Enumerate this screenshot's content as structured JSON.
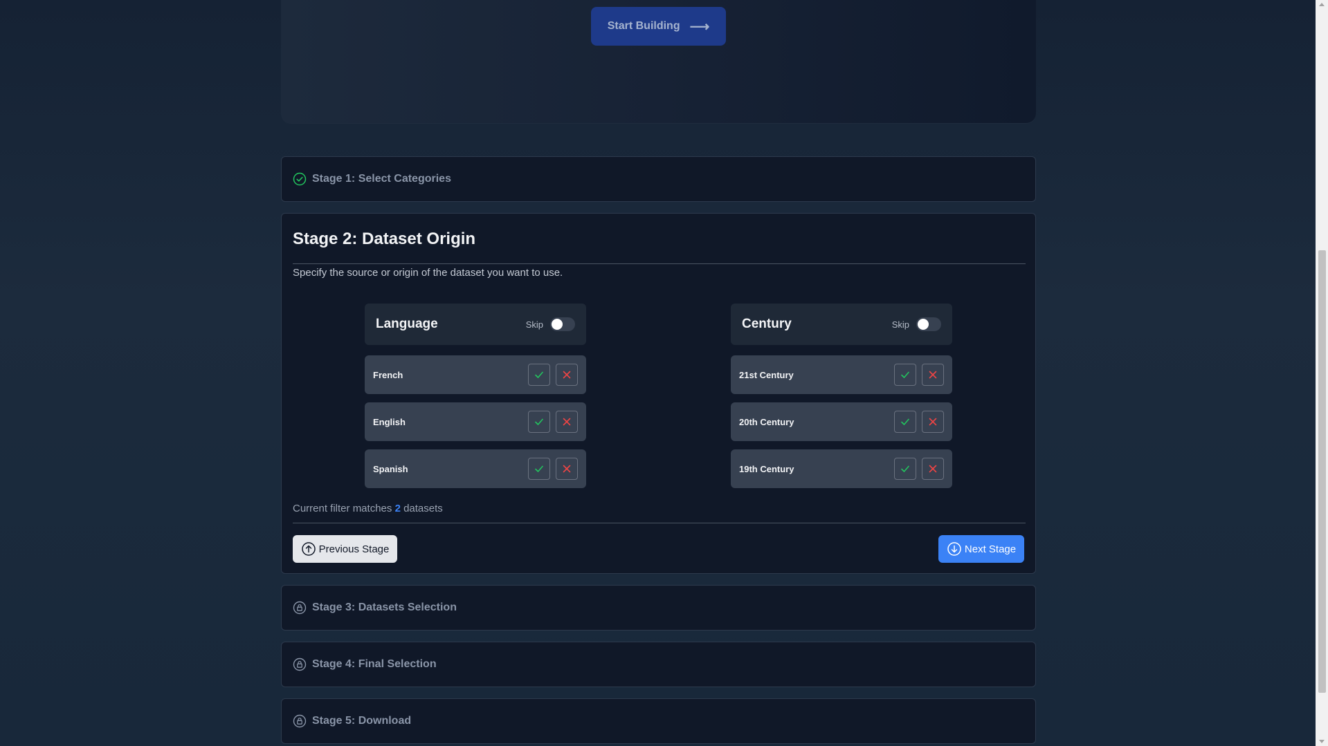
{
  "hero": {
    "start_label": "Start Building",
    "arrow_icon": "arrow-right-icon"
  },
  "stages": {
    "stage1": {
      "label": "Stage 1: Select Categories",
      "status": "completed",
      "icon": "check-circle-icon"
    },
    "stage2": {
      "title": "Stage 2: Dataset Origin",
      "description": "Specify the source or origin of the dataset you want to use.",
      "filters": [
        {
          "title": "Language",
          "skip_label": "Skip",
          "skip_on": false,
          "options": [
            {
              "label": "French"
            },
            {
              "label": "English"
            },
            {
              "label": "Spanish"
            }
          ]
        },
        {
          "title": "Century",
          "skip_label": "Skip",
          "skip_on": false,
          "options": [
            {
              "label": "21st Century"
            },
            {
              "label": "20th Century"
            },
            {
              "label": "19th Century"
            }
          ]
        }
      ],
      "status_prefix": "Current filter matches",
      "match_count": "2",
      "status_suffix": "datasets",
      "prev_label": "Previous Stage",
      "next_label": "Next Stage"
    },
    "stage3": {
      "label": "Stage 3: Datasets Selection",
      "status": "locked",
      "icon": "lock-icon"
    },
    "stage4": {
      "label": "Stage 4: Final Selection",
      "status": "locked",
      "icon": "lock-icon"
    },
    "stage5": {
      "label": "Stage 5: Download",
      "status": "locked",
      "icon": "lock-icon"
    }
  },
  "colors": {
    "accent": "#3b82f6",
    "success": "#22c55e",
    "danger": "#ef4444",
    "panel_bg": "#101828"
  }
}
